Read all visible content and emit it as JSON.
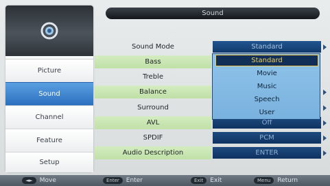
{
  "header": {
    "title": "Sound"
  },
  "sidebar": {
    "items": [
      {
        "label": "Picture",
        "active": false
      },
      {
        "label": "Sound",
        "active": true
      },
      {
        "label": "Channel",
        "active": false
      },
      {
        "label": "Feature",
        "active": false
      },
      {
        "label": "Setup",
        "active": false
      }
    ]
  },
  "menu": {
    "rows": [
      {
        "label": "Sound Mode",
        "value": "Standard"
      },
      {
        "label": "Bass",
        "value": ""
      },
      {
        "label": "Treble",
        "value": ""
      },
      {
        "label": "Balance",
        "value": ""
      },
      {
        "label": "Surround",
        "value": ""
      },
      {
        "label": "AVL",
        "value": "Off"
      },
      {
        "label": "SPDIF",
        "value": "PCM"
      },
      {
        "label": "Audio Description",
        "value": "ENTER"
      }
    ]
  },
  "dropdown": {
    "options": [
      "Standard",
      "Movie",
      "Music",
      "Speech",
      "User"
    ],
    "selected": "Standard"
  },
  "help_bar": {
    "items": [
      {
        "key": "◄►",
        "label": "Move"
      },
      {
        "key": "Enter",
        "label": "Enter"
      },
      {
        "key": "Exit",
        "label": "Exit"
      },
      {
        "key": "Menu",
        "label": "Return"
      }
    ]
  },
  "colors": {
    "accent_blue": "#2d6fc0",
    "value_box": "#123a6c",
    "row_highlight": "#c9e6b3",
    "dropdown_bg": "#86bce6",
    "selected_text": "#f2d15a"
  }
}
